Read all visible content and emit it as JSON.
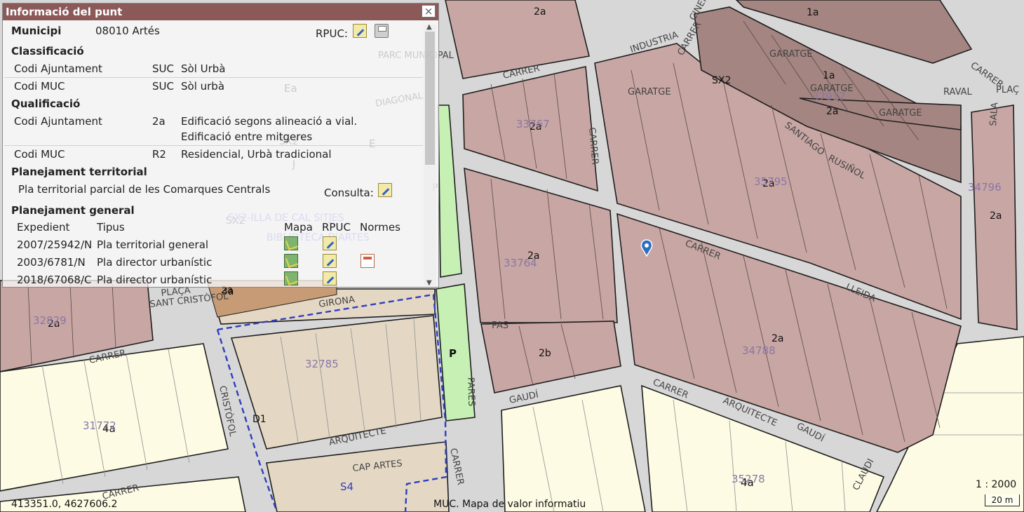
{
  "panel": {
    "title": "Informació del punt",
    "close_label": "×",
    "municipi_label": "Municipi",
    "municipi_value": "08010 Artés",
    "rpuc_label": "RPUC:",
    "classificacio": {
      "heading": "Classificació",
      "rows": [
        {
          "label": "Codi Ajuntament",
          "code": "SUC",
          "desc": "Sòl Urbà"
        },
        {
          "label": "Codi MUC",
          "code": "SUC",
          "desc": "Sòl urbà"
        }
      ]
    },
    "qualificacio": {
      "heading": "Qualificació",
      "rows": [
        {
          "label": "Codi Ajuntament",
          "code": "2a",
          "desc": "Edificació segons alineació a vial.",
          "desc2": "Edificació entre mitgeres"
        },
        {
          "label": "Codi MUC",
          "code": "R2",
          "desc": "Residencial, Urbà tradicional"
        }
      ]
    },
    "planejament_territorial": {
      "heading": "Planejament territorial",
      "item": "Pla territorial parcial de les Comarques Centrals",
      "consulta_label": "Consulta:"
    },
    "planejament_general": {
      "heading": "Planejament general",
      "columns": [
        "Expedient",
        "Tipus",
        "Mapa",
        "RPUC",
        "Normes"
      ],
      "rows": [
        {
          "expedient": "2007/25942/N",
          "tipus": "Pla territorial general"
        },
        {
          "expedient": "2003/6781/N",
          "tipus": "Pla director urbanístic"
        },
        {
          "expedient": "2018/67068/C",
          "tipus": "Pla director urbanístic"
        }
      ]
    }
  },
  "status": {
    "coordinates": "413351.0, 4627606.2",
    "caption": "MUC. Mapa de valor informatiu",
    "scale": "1 : 2000",
    "scalebar": "20 m"
  },
  "map": {
    "zone_labels": [
      "2a",
      "2a",
      "2a",
      "2a",
      "2a",
      "2a",
      "2a",
      "2a",
      "2a",
      "2b",
      "1a",
      "1a",
      "SX2",
      "SX2",
      "SX2",
      "Ea",
      "E",
      "J",
      "P",
      "P",
      "D1",
      "4a",
      "4a",
      "S4",
      "3a"
    ],
    "parcel_labels": [
      "33767",
      "33764",
      "34796",
      "34788",
      "35795",
      "32785",
      "31772",
      "32829",
      "35278",
      "37917"
    ],
    "street_labels": [
      "CARRER",
      "INDUSTRIA",
      "CARRER",
      "DIAGONAL",
      "CARRER",
      "CARRER",
      "SANTIAGO",
      "RUSIÑOL",
      "LLEIDA",
      "CARRER",
      "ARQUITECTE",
      "GAUDÍ",
      "GAUDÍ",
      "CARRER",
      "CRISTÒFOL",
      "CARRER",
      "ARQUITECTE",
      "GIRONA",
      "PLAÇA",
      "SANT CRISTÒFOL",
      "CARRER",
      "CLAUDI",
      "PARES",
      "CARRER",
      "CAP ARTES",
      "SX2-ILLA DE CAL SITJES",
      "BIBLIOTECA D'ARTES",
      "PARC MUNICIPAL",
      "GARATGE",
      "GARATGE",
      "GARATGE",
      "GARATGE",
      "RAVAL",
      "PLAÇ",
      "SALA",
      "CINEMA",
      "PAS"
    ],
    "colors": {
      "urban_dense": "#c7a6a3",
      "urban_dense_dark": "#a4807d",
      "garage_block": "#a88a86",
      "cream_block": "#fdfbe3",
      "tan_block": "#e4d8c5",
      "green_zone": "#c6f0b4",
      "blue_zone": "#cfe4f3",
      "road": "#d8d8d8",
      "marker": "#2e6fc0"
    }
  }
}
